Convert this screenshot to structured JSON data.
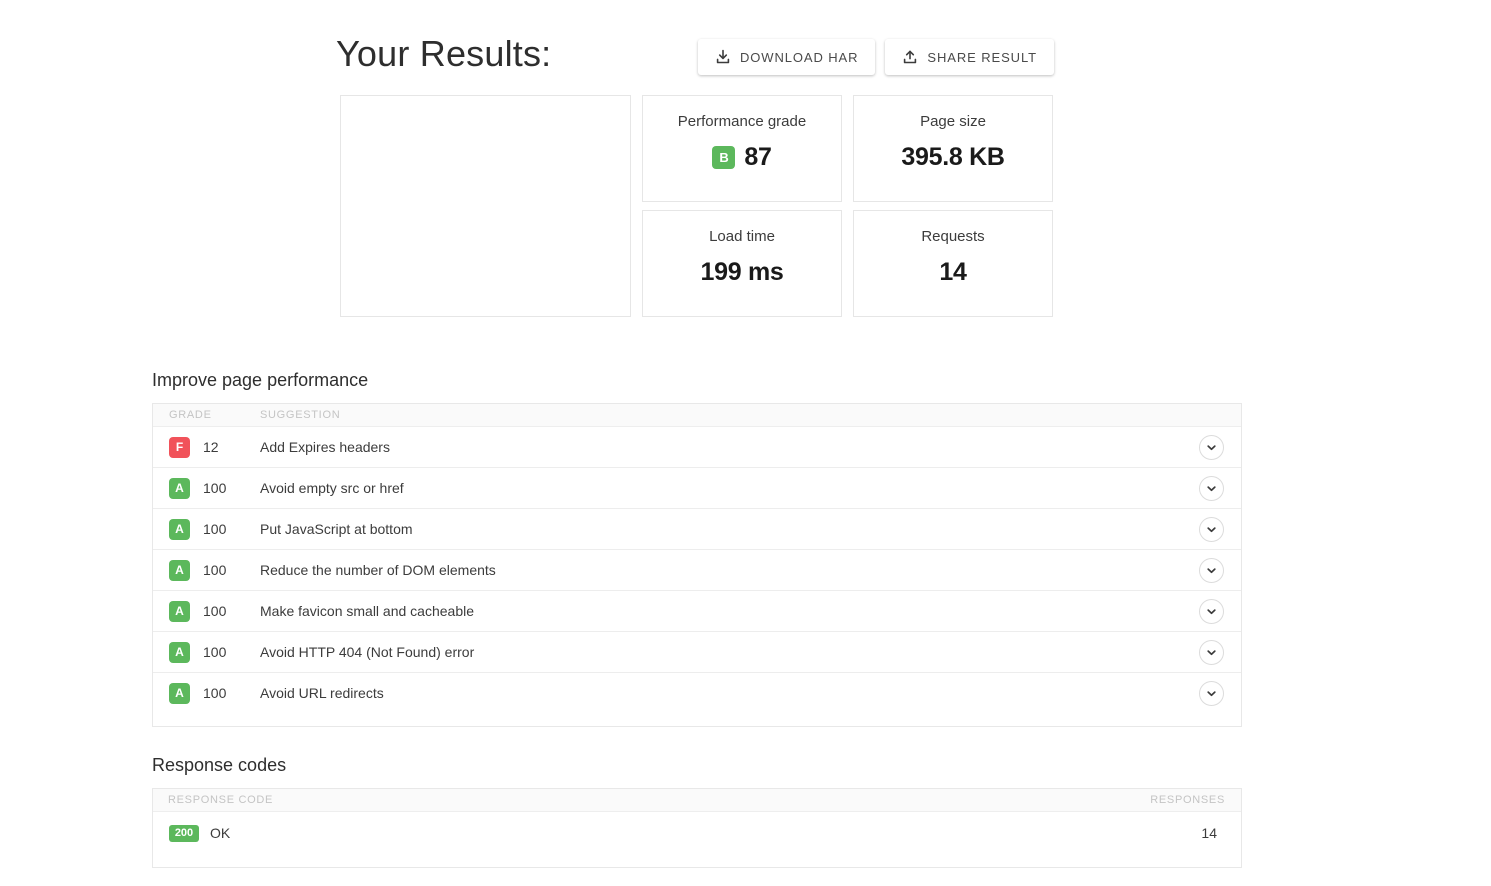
{
  "header": {
    "title": "Your Results:",
    "actions": [
      {
        "label": "DOWNLOAD HAR",
        "icon": "download-icon"
      },
      {
        "label": "SHARE RESULT",
        "icon": "share-upload-icon"
      }
    ]
  },
  "summary": {
    "screenshot_card": {
      "caption": ""
    },
    "metrics": [
      {
        "label": "Performance grade",
        "value": "87",
        "grade": "B",
        "grade_color": "#5cb85c"
      },
      {
        "label": "Page size",
        "value": "395.8 KB",
        "grade": null,
        "grade_color": null
      },
      {
        "label": "Load time",
        "value": "199 ms",
        "grade": null,
        "grade_color": null
      },
      {
        "label": "Requests",
        "value": "14",
        "grade": null,
        "grade_color": null
      }
    ]
  },
  "improve": {
    "title": "Improve page performance",
    "columns": {
      "grade": "GRADE",
      "suggestion": "SUGGESTION"
    },
    "rows": [
      {
        "grade": "F",
        "grade_color": "#f1525a",
        "score": "12",
        "suggestion": "Add Expires headers"
      },
      {
        "grade": "A",
        "grade_color": "#5cb85c",
        "score": "100",
        "suggestion": "Avoid empty src or href"
      },
      {
        "grade": "A",
        "grade_color": "#5cb85c",
        "score": "100",
        "suggestion": "Put JavaScript at bottom"
      },
      {
        "grade": "A",
        "grade_color": "#5cb85c",
        "score": "100",
        "suggestion": "Reduce the number of DOM elements"
      },
      {
        "grade": "A",
        "grade_color": "#5cb85c",
        "score": "100",
        "suggestion": "Make favicon small and cacheable"
      },
      {
        "grade": "A",
        "grade_color": "#5cb85c",
        "score": "100",
        "suggestion": "Avoid HTTP 404 (Not Found) error"
      },
      {
        "grade": "A",
        "grade_color": "#5cb85c",
        "score": "100",
        "suggestion": "Avoid URL redirects"
      }
    ]
  },
  "response_codes": {
    "title": "Response codes",
    "columns": {
      "code": "RESPONSE CODE",
      "responses": "RESPONSES"
    },
    "rows": [
      {
        "code": "200",
        "code_color": "#5cb85c",
        "label": "OK",
        "responses": "14"
      }
    ]
  }
}
